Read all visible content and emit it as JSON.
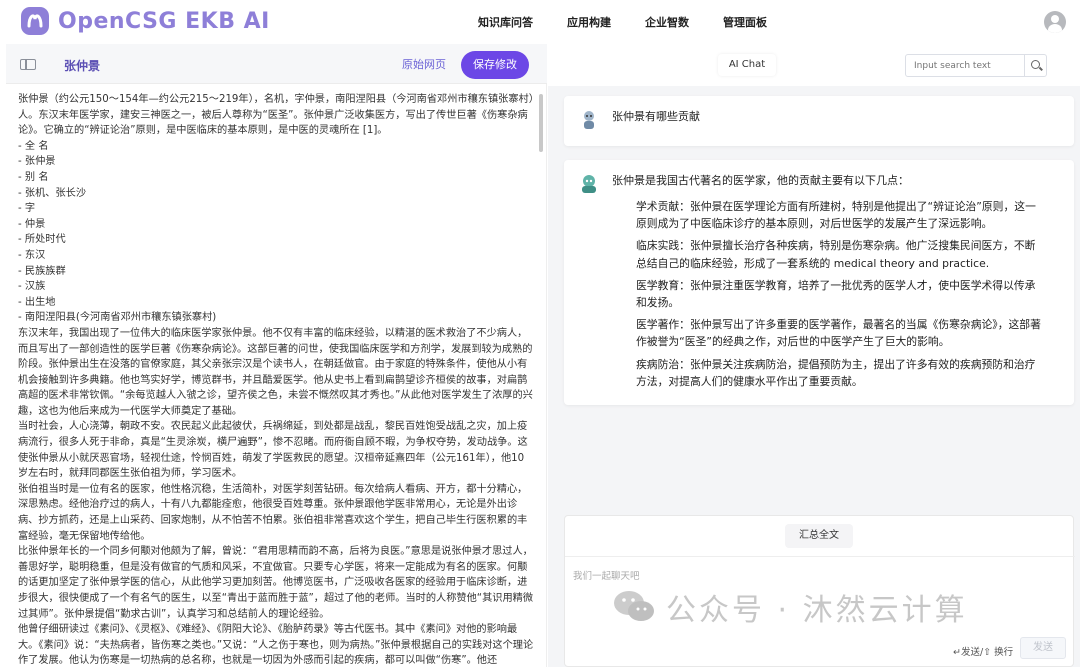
{
  "app": {
    "logo_text": "OpenCSG EKB AI",
    "nav": [
      "知识库问答",
      "应用构建",
      "企业智数",
      "管理面板"
    ],
    "brand_color": "#6c47e6"
  },
  "left": {
    "doc_title": "张仲景",
    "btn_source": "原始网页",
    "btn_save": "保存修改",
    "lines": [
      "张仲景（约公元150～154年—约公元215～219年），名机，字仲景，南阳涅阳县（今河南省邓州市穰东镇张寨村）人。东汉末年医学家，建安三神医之一，被后人尊称为“医圣”。张仲景广泛收集医方，写出了传世巨著《伤寒杂病论》。它确立的“辨证论治”原则，是中医临床的基本原则，是中医的灵魂所在 [1]。",
      "- 全 名",
      "- 张仲景",
      "- 别 名",
      "- 张机、张长沙",
      "- 字",
      "- 仲景",
      "- 所处时代",
      "- 东汉",
      "- 民族族群",
      "- 汉族",
      "- 出生地",
      "- 南阳涅阳县(今河南省邓州市穰东镇张寨村)",
      "东汉末年，我国出现了一位伟大的临床医学家张仲景。他不仅有丰富的临床经验，以精湛的医术救治了不少病人，而且写出了一部创造性的医学巨著《伤寒杂病论》。这部巨著的问世，使我国临床医学和方剂学，发展到较为成熟的阶段。张仲景出生在没落的官僚家庭，其父亲张宗汉是个读书人，在朝廷做官。由于家庭的特殊条件，使他从小有机会接触到许多典籍。他也笃实好学，博览群书，并且酷爱医学。他从史书上看到扁鹊望诊齐桓侯的故事，对扁鹊高超的医术非常钦佩。“余每览越人入虢之诊，望齐侯之色，未尝不慨然叹其才秀也。”从此他对医学发生了浓厚的兴趣，这也为他后来成为一代医学大师奠定了基础。",
      "当时社会，人心浇薄，朝政不安。农民起义此起彼伏，兵祸绵延，到处都是战乱，黎民百姓饱受战乱之灾，加上疫病流行，很多人死于非命，真是“生灵涂炭，横尸遍野”，惨不忍睹。而府衙自顾不暇，为争权夺势，发动战争。这使张仲景从小就厌恶官场，轻视仕途，怜悯百姓，萌发了学医救民的愿望。汉桓帝延熹四年（公元161年），他10岁左右时，就拜同郡医生张伯祖为师，学习医术。",
      "张伯祖当时是一位有名的医家，他性格沉稳，生活简朴，对医学刻苦钻研。每次给病人看病、开方，都十分精心，深思熟虑。经他治疗过的病人，十有八九都能痊愈，他很受百姓尊重。张仲景跟他学医非常用心，无论是外出诊病、抄方抓药，还是上山采药、回家炮制，从不怕苦不怕累。张伯祖非常喜欢这个学生，把自己毕生行医积累的丰富经验，毫无保留地传给他。",
      "比张仲景年长的一个同乡何颙对他颇为了解，曾说：“君用思精而韵不高，后将为良医。”意思是说张仲景才思过人，善思好学，聪明稳重，但是没有做官的气质和风采，不宜做官。只要专心学医，将来一定能成为有名的医家。何颙的话更加坚定了张仲景学医的信心，从此他学习更加刻苦。他博览医书，广泛吸收各医家的经验用于临床诊断，进步很大，很快便成了一个有名气的医生，以至“青出于蓝而胜于蓝”，超过了他的老师。当时的人称赞他“其识用精微过其师”。张仲景提倡“勤求古训”，认真学习和总结前人的理论经验。",
      "他曾仔细研读过《素问》、《灵枢》、《难经》、《阴阳大论》、《胎胪药录》等古代医书。其中《素问》对他的影响最大。《素问》说：“夫热病者，皆伤寒之类也。”又说：“人之伤于寒也，则为病热。”张仲景根据自己的实践对这个理论作了发展。他认为伤寒是一切热病的总名称，也就是一切因为外感而引起的疾病，都可以叫做“伤寒”。他还"
    ]
  },
  "right": {
    "tab_label": "AI Chat",
    "search_placeholder": "Input search text",
    "user_message": "张仲景有哪些贡献",
    "ai_intro": "张仲景是我国古代著名的医学家，他的贡献主要有以下几点：",
    "ai_points": [
      "学术贡献：张仲景在医学理论方面有所建树，特别是他提出了“辨证论治”原则，这一原则成为了中医临床诊疗的基本原则，对后世医学的发展产生了深远影响。",
      "临床实践：张仲景擅长治疗各种疾病，特别是伤寒杂病。他广泛搜集民间医方，不断总结自己的临床经验，形成了一套系统的 medical theory and practice.",
      "医学教育：张仲景注重医学教育，培养了一批优秀的医学人才，使中医学术得以传承和发扬。",
      "医学著作：张仲景写出了许多重要的医学著作，最著名的当属《伤寒杂病论》，这部著作被誉为“医圣”的经典之作，对后世的中医学产生了巨大的影响。",
      "疾病防治：张仲景关注疾病防治，提倡预防为主，提出了许多有效的疾病预防和治疗方法，对提高人们的健康水平作出了重要贡献。"
    ],
    "summary_btn": "汇总全文",
    "composer_placeholder": "我们一起聊天吧",
    "composer_hint": "↵发送/⇧ 换行",
    "send_btn": "发送"
  },
  "watermark": {
    "text": "公众号 · 沐然云计算"
  }
}
